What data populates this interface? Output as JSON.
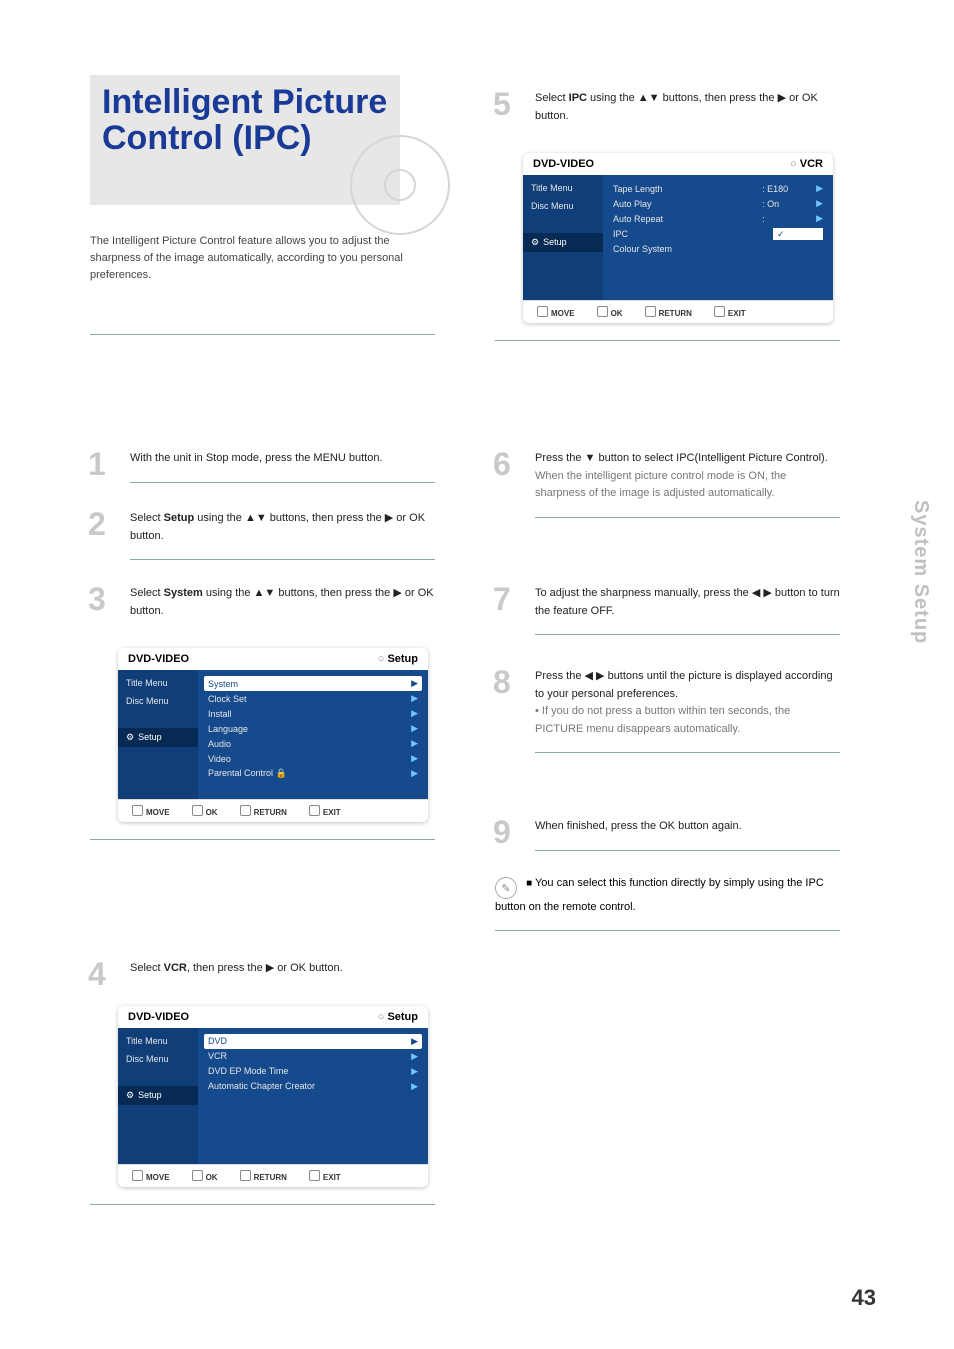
{
  "title": "Intelligent Picture Control (IPC)",
  "intro": "The Intelligent Picture Control feature allows you to adjust the sharpness of the image automatically, according to you personal preferences.",
  "side_label": "System Setup",
  "page_number": "43",
  "footer": {
    "move": "MOVE",
    "ok": "OK",
    "return": "RETURN",
    "exit": "EXIT"
  },
  "osd_title_left": "DVD-VIDEO",
  "osd_setup": "Setup",
  "osd_vcr": "VCR",
  "side_items": [
    "Title Menu",
    "Disc Menu",
    "",
    "Setup"
  ],
  "steps": {
    "s1": {
      "num": "1",
      "text": "With the unit in Stop mode, press the MENU button."
    },
    "s2": {
      "num": "2",
      "pre": "Select ",
      "bold": "Setup",
      "mid": " using the ",
      "arrows": "▲▼",
      "post": " buttons, then press the ",
      "arrow2": "▶",
      "post2": " or OK button."
    },
    "s3": {
      "num": "3",
      "pre": "Select ",
      "bold": "System",
      "mid": " using the ",
      "arrows": "▲▼",
      "post": " buttons, then press the ",
      "arrow2": "▶",
      "post2": " or OK button.",
      "menu": {
        "rows": [
          {
            "label": "System",
            "highlight": true
          },
          {
            "label": "Clock Set"
          },
          {
            "label": "Install"
          },
          {
            "label": "Language"
          },
          {
            "label": "Audio"
          },
          {
            "label": "Video"
          },
          {
            "label": "Parental Control 🔒"
          }
        ]
      }
    },
    "s4": {
      "num": "4",
      "pre": "Select ",
      "bold": "VCR",
      "mid": ", then press the ",
      "arrow2": "▶",
      "post2": " or OK button.",
      "menu": {
        "rows": [
          {
            "label": "DVD",
            "highlight": true
          },
          {
            "label": "VCR"
          },
          {
            "label": "DVD EP Mode Time"
          },
          {
            "label": "Automatic Chapter Creator"
          }
        ]
      }
    },
    "s5": {
      "num": "5",
      "pre": "Select ",
      "bold": "IPC",
      "mid": " using the ",
      "arrows": "▲▼",
      "post": " buttons, then press the ",
      "arrow2": "▶",
      "post2": " or OK button.",
      "menu": {
        "rows": [
          {
            "label": "Tape Length",
            "val": ": E180"
          },
          {
            "label": "Auto Play",
            "val": ": On"
          },
          {
            "label": "Auto Repeat",
            "val": ":"
          },
          {
            "label": "IPC",
            "checkbox": true
          },
          {
            "label": "Colour System"
          }
        ]
      }
    },
    "s6": {
      "num": "6",
      "pre": "Press the ",
      "arrows": "▼",
      "post": " button to select IPC(Intelligent Picture Control).",
      "post2": "When the intelligent picture control mode is ON, the sharpness of the image is adjusted automatically."
    },
    "s7": {
      "num": "7",
      "pre": "To adjust the sharpness manually, press the ",
      "arrows": "◀ ▶",
      "post": " button to turn the feature OFF."
    },
    "s8": {
      "num": "8",
      "pre": "Press the ",
      "arrows": "◀ ▶",
      "post": " buttons until the picture is displayed according to your personal preferences.",
      "bullet": "If you do not press a button within ten seconds, the PICTURE menu disappears automatically."
    },
    "s9": {
      "num": "9",
      "pre": "When finished, press the OK button again."
    }
  },
  "note": {
    "text": "You can select this function directly by simply using the IPC button on the remote control."
  }
}
